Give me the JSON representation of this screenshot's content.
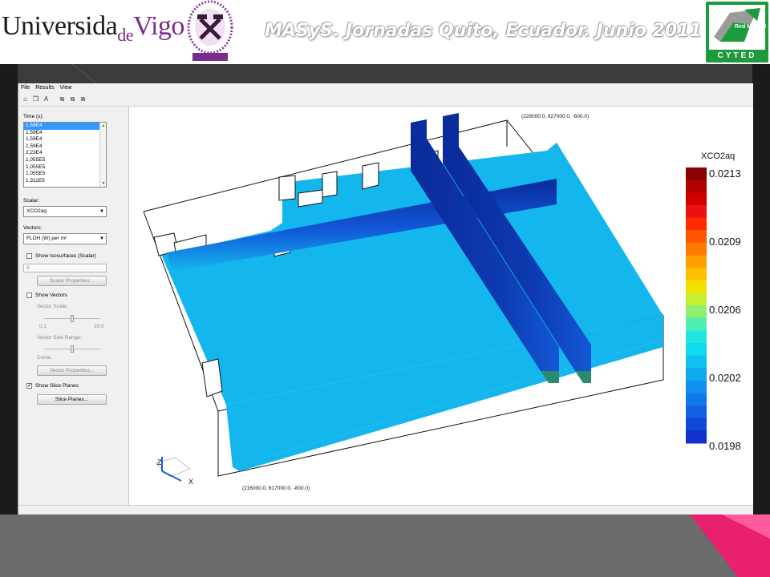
{
  "slide": {
    "title": "MASyS. Jornadas Quito, Ecuador. Junio 2011",
    "university_logo_text": "Universidade Vigo",
    "cyted_logo_text": "CYTED",
    "red_masys_text": "Red MASyS"
  },
  "menu": [
    "File",
    "Results",
    "View"
  ],
  "panel": {
    "time_label": "Time (s):",
    "time_items": [
      "1,59E4",
      "1,59E4",
      "1,59E4",
      "1,59E4",
      "2,23E4",
      "1,055E5",
      "1,055E5",
      "1,055E5",
      "1,311E5"
    ],
    "scalar_label": "Scalar:",
    "scalar_value": "XCO2aq",
    "vectors_label": "Vectors:",
    "vectors_value": "FLOH (W) per m²",
    "show_isosurfaces": "Show Isosurfaces (Scalar)",
    "iso_value": "6",
    "scalar_properties": "Scalar Properties...",
    "show_vectors": "Show Vectors",
    "vector_scale": "Vector Scale:",
    "scale_min": "0.1",
    "scale_max": "10.0",
    "vector_size_range": "Vector Size Range:",
    "const": "Const.",
    "vector_properties": "Vector Properties...",
    "show_slice_planes": "Show Slice Planes",
    "slice_planes": "Slice Planes...",
    "isosurfaces_checked": false,
    "vectors_checked": false,
    "slice_planes_checked": true
  },
  "viewport": {
    "corner_top": "(228000.0, 827000.0, -600.0)",
    "corner_bottom": "(216000.0, 817000.0, -800.0)",
    "axis_z": "Z",
    "axis_x": "X"
  },
  "colorbar": {
    "title": "XCO2aq",
    "ticks": [
      "0.0213",
      "0.0209",
      "0.0206",
      "0.0202",
      "0.0198"
    ],
    "colors": [
      "#8b0000",
      "#b00000",
      "#d40000",
      "#ee1010",
      "#ff2a00",
      "#ff5500",
      "#ff7b00",
      "#ffa000",
      "#ffc000",
      "#f2e000",
      "#c8ee30",
      "#90ee70",
      "#50eeb0",
      "#20e8e0",
      "#10d8f0",
      "#10c0f0",
      "#10a8f0",
      "#1090f0",
      "#1078e8",
      "#1060e0",
      "#1048d8",
      "#1030d0"
    ]
  },
  "colors": {
    "fluid": "#14b6ee",
    "slice_dark": "#0a2a9a",
    "slide_band": "#3b3b3b",
    "pink_accent": "#e8206e"
  }
}
